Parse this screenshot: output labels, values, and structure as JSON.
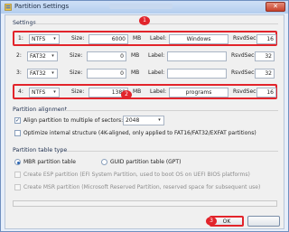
{
  "window": {
    "title": "Partition Settings",
    "close_glyph": "✕"
  },
  "settings": {
    "section_label": "Settings",
    "labels": {
      "size": "Size:",
      "unit": "MB",
      "label": "Label:",
      "rsvd": "RsvdSecs:"
    },
    "rows": [
      {
        "index": "1:",
        "fs": "NTFS",
        "size": "6000",
        "label": "Windows",
        "rsvd": "16",
        "highlighted": true,
        "badge": "1"
      },
      {
        "index": "2:",
        "fs": "FAT32",
        "size": "0",
        "label": "",
        "rsvd": "32",
        "highlighted": false
      },
      {
        "index": "3:",
        "fs": "FAT32",
        "size": "0",
        "label": "",
        "rsvd": "32",
        "highlighted": false
      },
      {
        "index": "4:",
        "fs": "NTFS",
        "size": "1388",
        "label": "programs",
        "rsvd": "16",
        "highlighted": true,
        "badge": "2"
      }
    ]
  },
  "alignment": {
    "section_label": "Partition alignment",
    "align_checkbox_label": "Align partition to multiple of sectors:",
    "align_checked": true,
    "align_value": "2048",
    "optimize_label": "Optimize internal structure (4K-aligned, only applied to FAT16/FAT32/EXFAT partitions)",
    "optimize_checked": false
  },
  "table_type": {
    "section_label": "Partition table type",
    "mbr_label": "MBR partition table",
    "gpt_label": "GUID partition table (GPT)",
    "esp_label": "Create ESP partition (EFI System Partition, used to boot OS on UEFI BIOS platforms)",
    "msr_label": "Create MSR partition (Microsoft Reserved Partition, reserved space for subsequent use)"
  },
  "buttons": {
    "ok": "OK",
    "cancel": "",
    "ok_badge": "3"
  },
  "colors": {
    "highlight": "#e2242b",
    "title_bar": "#b3cdee",
    "accent": "#2a65b3"
  },
  "icons": {
    "app": "partition-app-icon",
    "dropdown": "chevron-down-icon",
    "check": "checkmark-icon"
  }
}
